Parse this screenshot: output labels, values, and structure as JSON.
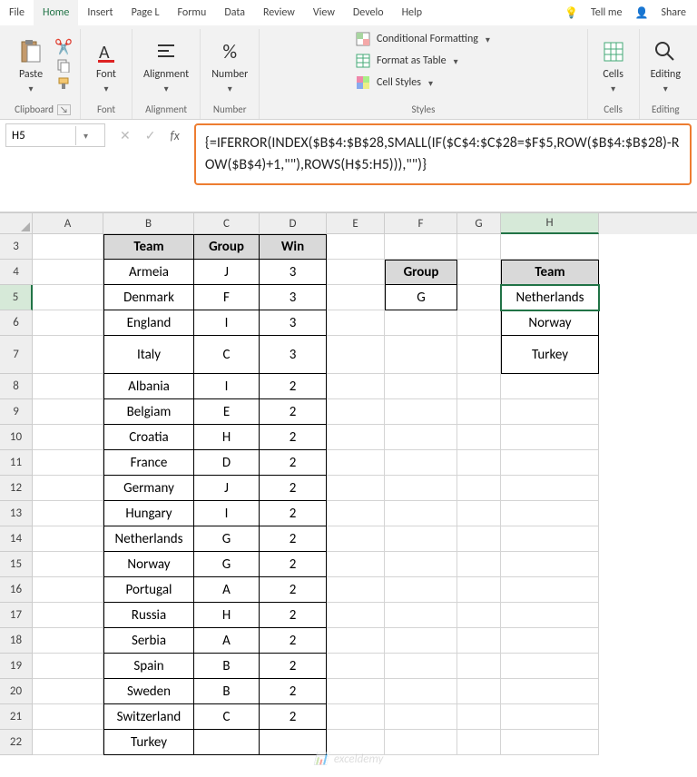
{
  "menu": {
    "file": "File",
    "home": "Home",
    "insert": "Insert",
    "page": "Page L",
    "formulas": "Formu",
    "data": "Data",
    "review": "Review",
    "view": "View",
    "developer": "Develo",
    "help": "Help",
    "tellme": "Tell me",
    "share": "Share"
  },
  "ribbon": {
    "clipboard": {
      "label": "Clipboard",
      "paste": "Paste"
    },
    "font": {
      "label": "Font",
      "btn": "Font"
    },
    "alignment": {
      "label": "Alignment",
      "btn": "Alignment"
    },
    "number": {
      "label": "Number",
      "btn": "Number"
    },
    "styles": {
      "label": "Styles",
      "cond": "Conditional Formatting",
      "table": "Format as Table",
      "cellstyles": "Cell Styles"
    },
    "cells": {
      "label": "Cells",
      "btn": "Cells"
    },
    "editing": {
      "label": "Editing",
      "btn": "Editing"
    }
  },
  "namebox": "H5",
  "formula": "{=IFERROR(INDEX($B$4:$B$28,SMALL(IF($C$4:$C$28=$F$5,ROW($B$4:$B$28)-ROW($B$4)+1,\"\"),ROWS(H$5:H5))),\"\")}",
  "cols": [
    "A",
    "B",
    "C",
    "D",
    "E",
    "F",
    "G",
    "H"
  ],
  "header": {
    "team": "Team",
    "group": "Group",
    "win": "Win"
  },
  "rows": [
    {
      "r": 4,
      "team": "Armeia",
      "group": "J",
      "win": "3"
    },
    {
      "r": 5,
      "team": "Denmark",
      "group": "F",
      "win": "3"
    },
    {
      "r": 6,
      "team": "England",
      "group": "I",
      "win": "3"
    },
    {
      "r": 7,
      "team": "Italy",
      "group": "C",
      "win": "3",
      "tall": true
    },
    {
      "r": 8,
      "team": "Albania",
      "group": "I",
      "win": "2"
    },
    {
      "r": 9,
      "team": "Belgiam",
      "group": "E",
      "win": "2"
    },
    {
      "r": 10,
      "team": "Croatia",
      "group": "H",
      "win": "2"
    },
    {
      "r": 11,
      "team": "France",
      "group": "D",
      "win": "2"
    },
    {
      "r": 12,
      "team": "Germany",
      "group": "J",
      "win": "2"
    },
    {
      "r": 13,
      "team": "Hungary",
      "group": "I",
      "win": "2"
    },
    {
      "r": 14,
      "team": "Netherlands",
      "group": "G",
      "win": "2"
    },
    {
      "r": 15,
      "team": "Norway",
      "group": "G",
      "win": "2"
    },
    {
      "r": 16,
      "team": "Portugal",
      "group": "A",
      "win": "2"
    },
    {
      "r": 17,
      "team": "Russia",
      "group": "H",
      "win": "2"
    },
    {
      "r": 18,
      "team": "Serbia",
      "group": "A",
      "win": "2"
    },
    {
      "r": 19,
      "team": "Spain",
      "group": "B",
      "win": "2"
    },
    {
      "r": 20,
      "team": "Sweden",
      "group": "B",
      "win": "2"
    },
    {
      "r": 21,
      "team": "Switzerland",
      "group": "C",
      "win": "2"
    },
    {
      "r": 22,
      "team": "Turkey",
      "group": "",
      "win": ""
    }
  ],
  "lookup": {
    "grouphdr": "Group",
    "groupval": "G",
    "teamhdr": "Team",
    "results": [
      "Netherlands",
      "Norway",
      "Turkey"
    ]
  },
  "watermark": "exceldemy"
}
